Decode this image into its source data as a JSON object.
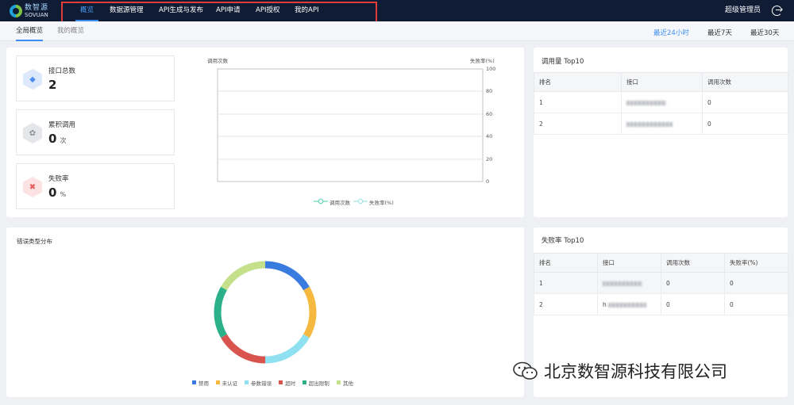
{
  "app": {
    "logo_cn": "数智源",
    "logo_en": "SOVUAN"
  },
  "nav": {
    "items": [
      {
        "label": "概览",
        "active": true
      },
      {
        "label": "数据源管理",
        "active": false
      },
      {
        "label": "API生成与发布",
        "active": false
      },
      {
        "label": "API申请",
        "active": false
      },
      {
        "label": "API授权",
        "active": false
      },
      {
        "label": "我的API",
        "active": false
      }
    ],
    "user": "超级管理员"
  },
  "subtabs": [
    {
      "label": "全局概览",
      "active": true
    },
    {
      "label": "我的概览",
      "active": false
    }
  ],
  "ranges": [
    {
      "label": "最近24小时",
      "active": true
    },
    {
      "label": "最近7天",
      "active": false
    },
    {
      "label": "最近30天",
      "active": false
    }
  ],
  "stats": [
    {
      "label": "接口总数",
      "value": "2",
      "unit": "",
      "icon": "api-icon",
      "color": "#4d8ef0"
    },
    {
      "label": "累积调用",
      "value": "0",
      "unit": "次",
      "icon": "invoke-icon",
      "color": "#8a8f99"
    },
    {
      "label": "失败率",
      "value": "0",
      "unit": "%",
      "icon": "error-icon",
      "color": "#e85b5b"
    }
  ],
  "call_chart": {
    "left_axis_label": "调用次数",
    "right_axis_label": "失败率(%)",
    "right_ticks": [
      "100",
      "80",
      "60",
      "40",
      "20",
      "0"
    ],
    "legend": [
      "调用次数",
      "失败率(%)"
    ],
    "colors": [
      "#6fd3b8",
      "#a5e6e8"
    ]
  },
  "top_calls": {
    "title": "调用量 Top10",
    "columns": [
      "排名",
      "接口",
      "调用次数"
    ],
    "rows": [
      {
        "rank": "1",
        "count": "0"
      },
      {
        "rank": "2",
        "count": "0"
      }
    ]
  },
  "top_fail": {
    "title": "失败率 Top10",
    "columns": [
      "排名",
      "接口",
      "调用次数",
      "失败率(%)"
    ],
    "rows": [
      {
        "rank": "1",
        "count": "0",
        "rate": "0"
      },
      {
        "rank": "2",
        "prefix": "h",
        "count": "0",
        "rate": "0"
      }
    ]
  },
  "error_dist": {
    "title": "错误类型分布"
  },
  "chart_data": {
    "type": "pie",
    "title": "错误类型分布",
    "categories": [
      "禁用",
      "未认证",
      "参数错误",
      "超时",
      "超出限制",
      "其他"
    ],
    "values": [
      1,
      1,
      1,
      1,
      1,
      1
    ],
    "colors": [
      "#3a7be0",
      "#f5b940",
      "#8fe0f0",
      "#d9534f",
      "#2bb08a",
      "#c5e08a"
    ],
    "legend": "bottom"
  },
  "watermark": "北京数智源科技有限公司"
}
